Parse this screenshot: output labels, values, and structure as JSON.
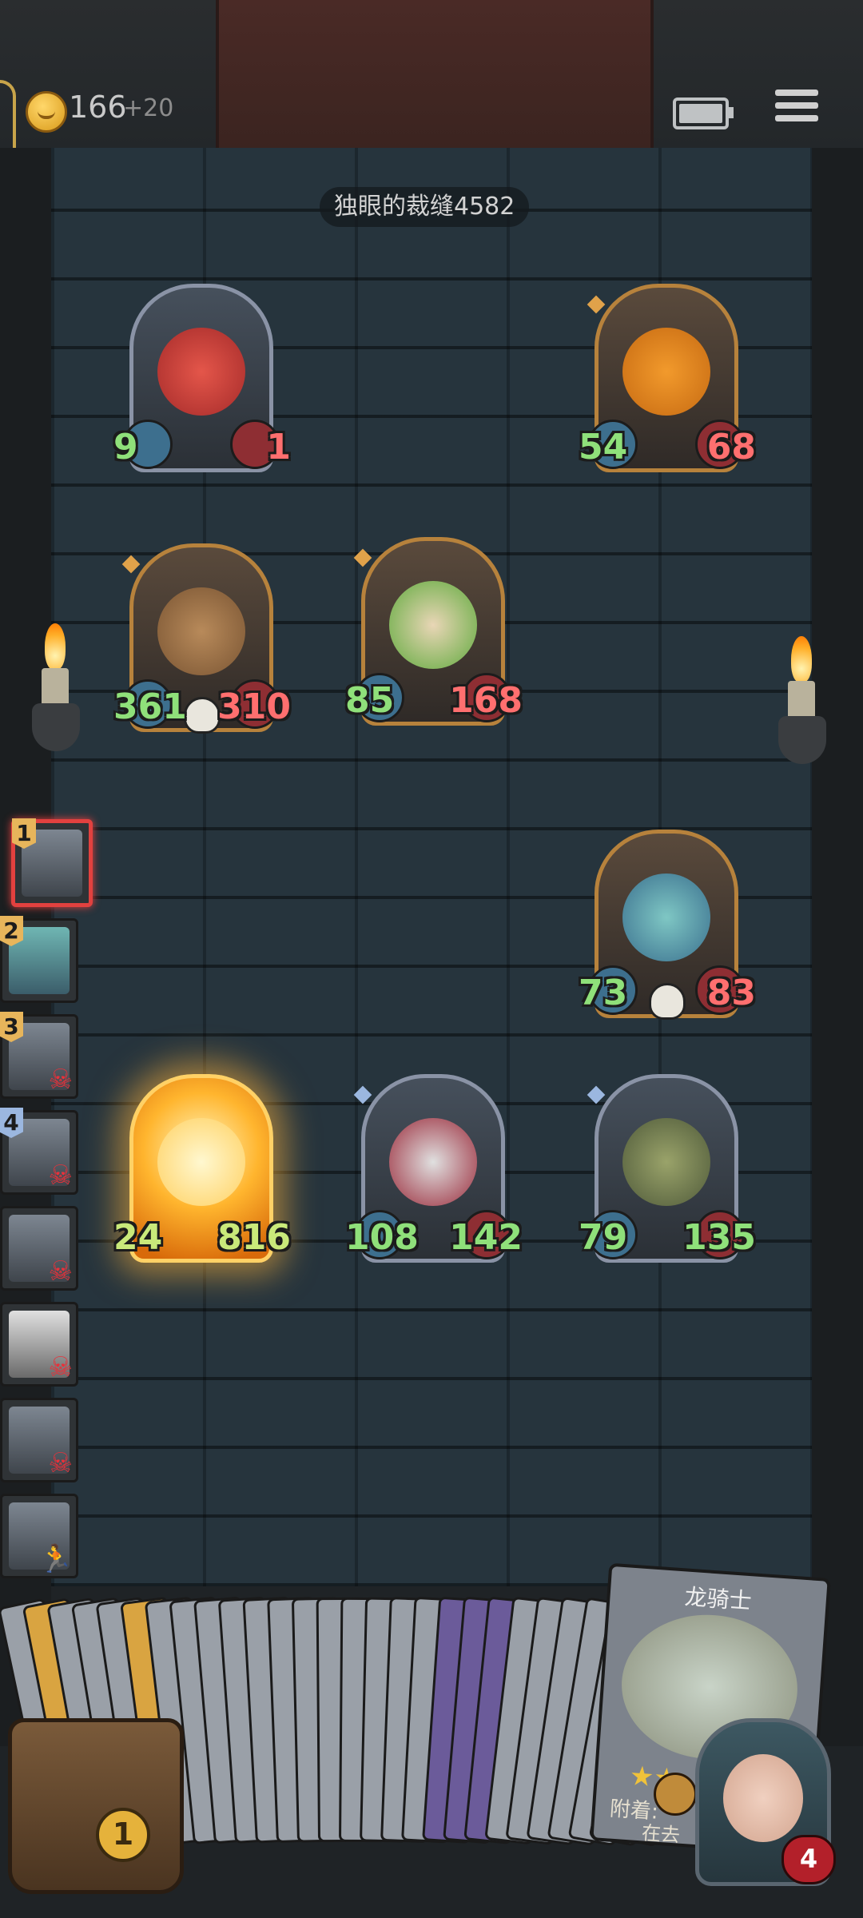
{
  "top_bar": {
    "gold": "166",
    "gold_bonus": "+20"
  },
  "enemy": {
    "name": "独眼的裁缝4582"
  },
  "units": [
    {
      "atk": "9",
      "hp": "1"
    },
    {
      "atk": "54",
      "hp": "68"
    },
    {
      "atk": "361",
      "hp": "310"
    },
    {
      "atk": "85",
      "hp": "168"
    },
    {
      "atk": "73",
      "hp": "83"
    },
    {
      "atk": "24",
      "hp": "816"
    },
    {
      "atk": "108",
      "hp": "142"
    },
    {
      "atk": "79",
      "hp": "135"
    }
  ],
  "queue": [
    {
      "number": "1",
      "state": "active"
    },
    {
      "number": "2",
      "state": "alive"
    },
    {
      "number": "3",
      "state": "dead"
    },
    {
      "number": "4",
      "state": "dead"
    },
    {
      "number": "",
      "state": "dead"
    },
    {
      "number": "",
      "state": "dead"
    },
    {
      "number": "",
      "state": "dead"
    },
    {
      "number": "",
      "state": "fleeing"
    }
  ],
  "featured_card": {
    "name": "龙骑士",
    "desc": "附着:",
    "desc_line2": "在去",
    "stars": "★★"
  },
  "chest": {
    "count": "1"
  },
  "player": {
    "lives": "4"
  },
  "colors": {
    "attack": "#8fe07a",
    "health": "#ff6f6f",
    "gold_frame": "#b7823c",
    "silver_frame": "#8a93a6",
    "dead_mark": "#e8313a"
  }
}
